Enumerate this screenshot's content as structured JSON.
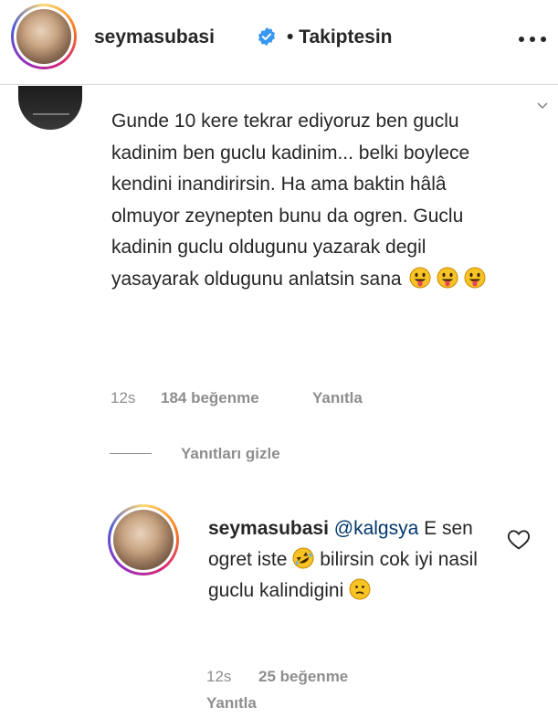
{
  "header": {
    "username": "seymasubasi",
    "follow_status": "• Takiptesin",
    "icons": {
      "avatar": "profile-avatar",
      "verified": "verified-badge-icon",
      "more": "more-options-icon"
    },
    "verified_color": "#3897f0"
  },
  "comment": {
    "text": "Gunde 10 kere tekrar ediyoruz ben guclu kadinim ben guclu kadinim... belki boylece kendini inandirirsin. Ha ama baktin hâlâ olmuyor zeynepten bunu da ogren. Guclu kadinin guclu oldugunu yazarak degil yasayarak oldugunu anlatsin sana",
    "emojis": [
      "tongue-out-emoji",
      "tongue-out-emoji",
      "tongue-out-emoji"
    ],
    "time": "12s",
    "likes": "184 beğenme",
    "reply_label": "Yanıtla"
  },
  "replies_toggle": "Yanıtları gizle",
  "reply": {
    "username": "seymasubasi",
    "mention": "@kalgsya",
    "text_part1": " E sen ogret iste",
    "text_part2": " bilirsin cok iyi nasil guclu kalindigini",
    "emojis": [
      "rolling-laughing-emoji",
      "confused-emoji"
    ],
    "time": "12s",
    "likes": "25 beğenme",
    "reply_label": "Yanıtla"
  },
  "colors": {
    "text": "#262626",
    "muted": "#8e8e8e",
    "mention": "#00376b",
    "border": "#dbdbdb"
  }
}
